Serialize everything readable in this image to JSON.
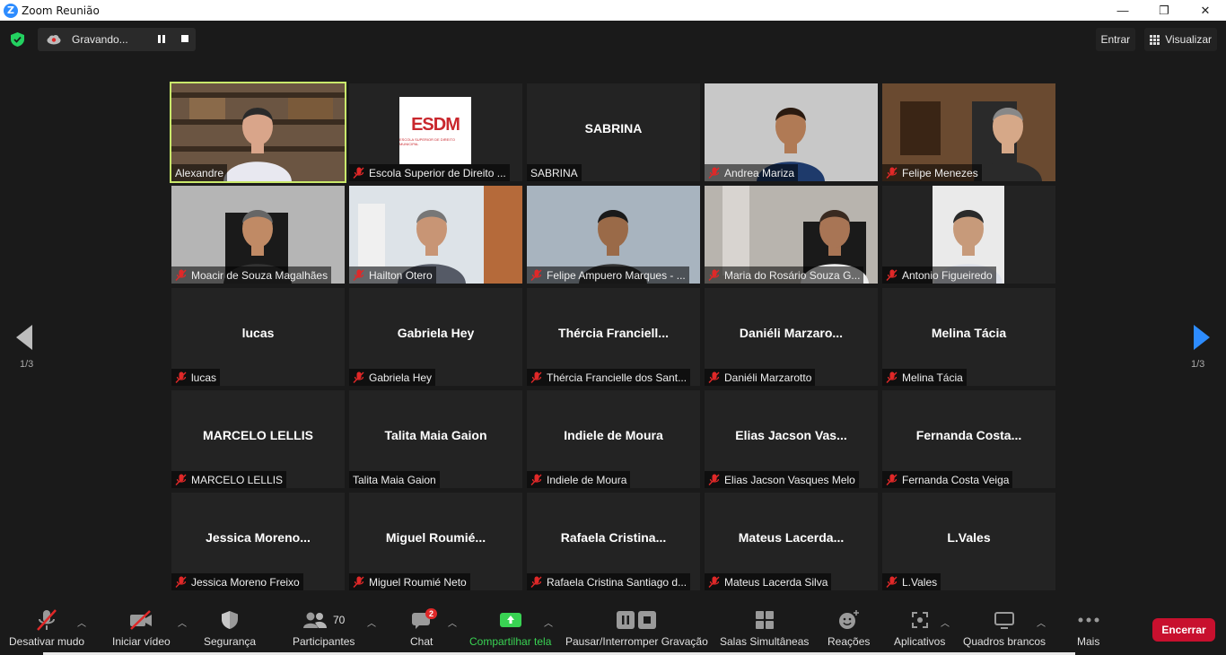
{
  "window": {
    "title": "Zoom Reunião",
    "minimize": "—",
    "maximize": "❐",
    "close": "✕",
    "logo_letter": "Z"
  },
  "recording": {
    "status": "Gravando..."
  },
  "top_right": {
    "enter_label": "Entrar",
    "view_label": "Visualizar"
  },
  "pagination": {
    "left": "1/3",
    "right": "1/3"
  },
  "tiles": [
    {
      "label": "Alexandre",
      "big": "",
      "muted": false,
      "kind": "video-alexandre"
    },
    {
      "label": "Escola Superior de Direito ...",
      "big": "",
      "muted": true,
      "kind": "logo"
    },
    {
      "label": "SABRINA",
      "big": "SABRINA",
      "muted": false,
      "kind": "name"
    },
    {
      "label": "Andrea Mariza",
      "big": "",
      "muted": true,
      "kind": "video-andrea"
    },
    {
      "label": "Felipe Menezes",
      "big": "",
      "muted": true,
      "kind": "video-felipe"
    },
    {
      "label": "Moacir de Souza Magalhães",
      "big": "",
      "muted": true,
      "kind": "video-moacir"
    },
    {
      "label": "Hailton Otero",
      "big": "",
      "muted": true,
      "kind": "video-hailton"
    },
    {
      "label": "Felipe Ampuero Marques - ...",
      "big": "",
      "muted": true,
      "kind": "video-ampuero"
    },
    {
      "label": "Maria do Rosário Souza G...",
      "big": "",
      "muted": true,
      "kind": "video-maria"
    },
    {
      "label": "Antonio Figueiredo",
      "big": "",
      "muted": true,
      "kind": "video-antonio"
    },
    {
      "label": "lucas",
      "big": "lucas",
      "muted": true,
      "kind": "name"
    },
    {
      "label": "Gabriela Hey",
      "big": "Gabriela Hey",
      "muted": true,
      "kind": "name"
    },
    {
      "label": "Thércia Francielle dos Sant...",
      "big": "Thércia  Franciell...",
      "muted": true,
      "kind": "name"
    },
    {
      "label": "Daniéli Marzarotto",
      "big": "Daniéli  Marzaro...",
      "muted": true,
      "kind": "name"
    },
    {
      "label": "Melina Tácia",
      "big": "Melina Tácia",
      "muted": true,
      "kind": "name"
    },
    {
      "label": "MARCELO LELLIS",
      "big": "MARCELO LELLIS",
      "muted": true,
      "kind": "name"
    },
    {
      "label": "Talita Maia Gaion",
      "big": "Talita Maia Gaion",
      "muted": false,
      "kind": "name"
    },
    {
      "label": "Indiele de Moura",
      "big": "Indiele de Moura",
      "muted": true,
      "kind": "name"
    },
    {
      "label": "Elias Jacson Vasques Melo",
      "big": "Elias Jacson Vas...",
      "muted": true,
      "kind": "name"
    },
    {
      "label": "Fernanda Costa Veiga",
      "big": "Fernanda  Costa...",
      "muted": true,
      "kind": "name"
    },
    {
      "label": "Jessica Moreno Freixo",
      "big": "Jessica  Moreno...",
      "muted": true,
      "kind": "name"
    },
    {
      "label": "Miguel Roumié Neto",
      "big": "Miguel  Roumié...",
      "muted": true,
      "kind": "name"
    },
    {
      "label": "Rafaela Cristina Santiago d...",
      "big": "Rafaela  Cristina...",
      "muted": true,
      "kind": "name"
    },
    {
      "label": "Mateus Lacerda Silva",
      "big": "Mateus  Lacerda...",
      "muted": true,
      "kind": "name"
    },
    {
      "label": "L.Vales",
      "big": "L.Vales",
      "muted": true,
      "kind": "name"
    }
  ],
  "logo": {
    "text": "ESDM",
    "sub": "ESCOLA SUPERIOR DE DIREITO MUNICIPAL"
  },
  "toolbar": {
    "mute": "Desativar mudo",
    "video": "Iniciar vídeo",
    "security": "Segurança",
    "participants": "Participantes",
    "participants_count": "70",
    "chat": "Chat",
    "chat_badge": "2",
    "share": "Compartilhar tela",
    "recording": "Pausar/Interromper Gravação",
    "breakout": "Salas Simultâneas",
    "reactions": "Reações",
    "apps": "Aplicativos",
    "whiteboards": "Quadros brancos",
    "more": "Mais",
    "end": "Encerrar"
  },
  "colors": {
    "accent": "#2d8cff",
    "active_speaker": "#c9e86b",
    "end": "#c8102e",
    "share": "#39d353"
  }
}
